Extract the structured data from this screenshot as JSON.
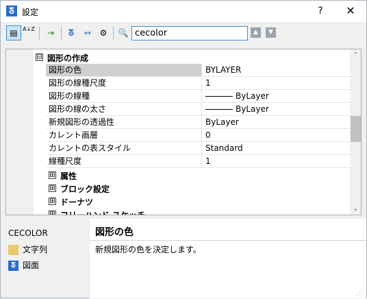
{
  "window": {
    "title": "設定",
    "help": "?",
    "close": "✕"
  },
  "toolbar": {
    "search_value": "cecolor",
    "categorized_glyph": "▤",
    "alpha_glyph": "A↓Z",
    "export_glyph": "⇥",
    "app_glyph": "ᘕ",
    "width_glyph": "↔",
    "settings_glyph": "⚙",
    "find_glyph": "🔍",
    "prev_glyph": "▲",
    "next_glyph": "▼"
  },
  "grid": {
    "category": {
      "toggle": "⊟",
      "label": "図形の作成"
    },
    "properties": [
      {
        "name": "図形の色",
        "value": "BYLAYER"
      },
      {
        "name": "図形の線種尺度",
        "value": "1"
      },
      {
        "name": "図形の線種",
        "value": "ByLayer"
      },
      {
        "name": "図形の線の太さ",
        "value": "ByLayer"
      },
      {
        "name": "新規図形の透過性",
        "value": "ByLayer"
      },
      {
        "name": "カレント画層",
        "value": "0"
      },
      {
        "name": "カレントの表スタイル",
        "value": "Standard"
      },
      {
        "name": "線種尺度",
        "value": "1"
      }
    ],
    "subcategories": [
      {
        "toggle": "⊞",
        "label": "属性"
      },
      {
        "toggle": "⊞",
        "label": "ブロック設定"
      },
      {
        "toggle": "⊞",
        "label": "ドーナツ"
      },
      {
        "toggle": "⊞",
        "label": "フリーハンド スケッチ"
      }
    ],
    "scroll_up": "⌃",
    "scroll_down": "⌄"
  },
  "info": {
    "variable": "CECOLOR",
    "type_label": "文字列",
    "scope_label": "図面",
    "desc_title": "図形の色",
    "desc_text": "新規図形の色を決定します。"
  }
}
